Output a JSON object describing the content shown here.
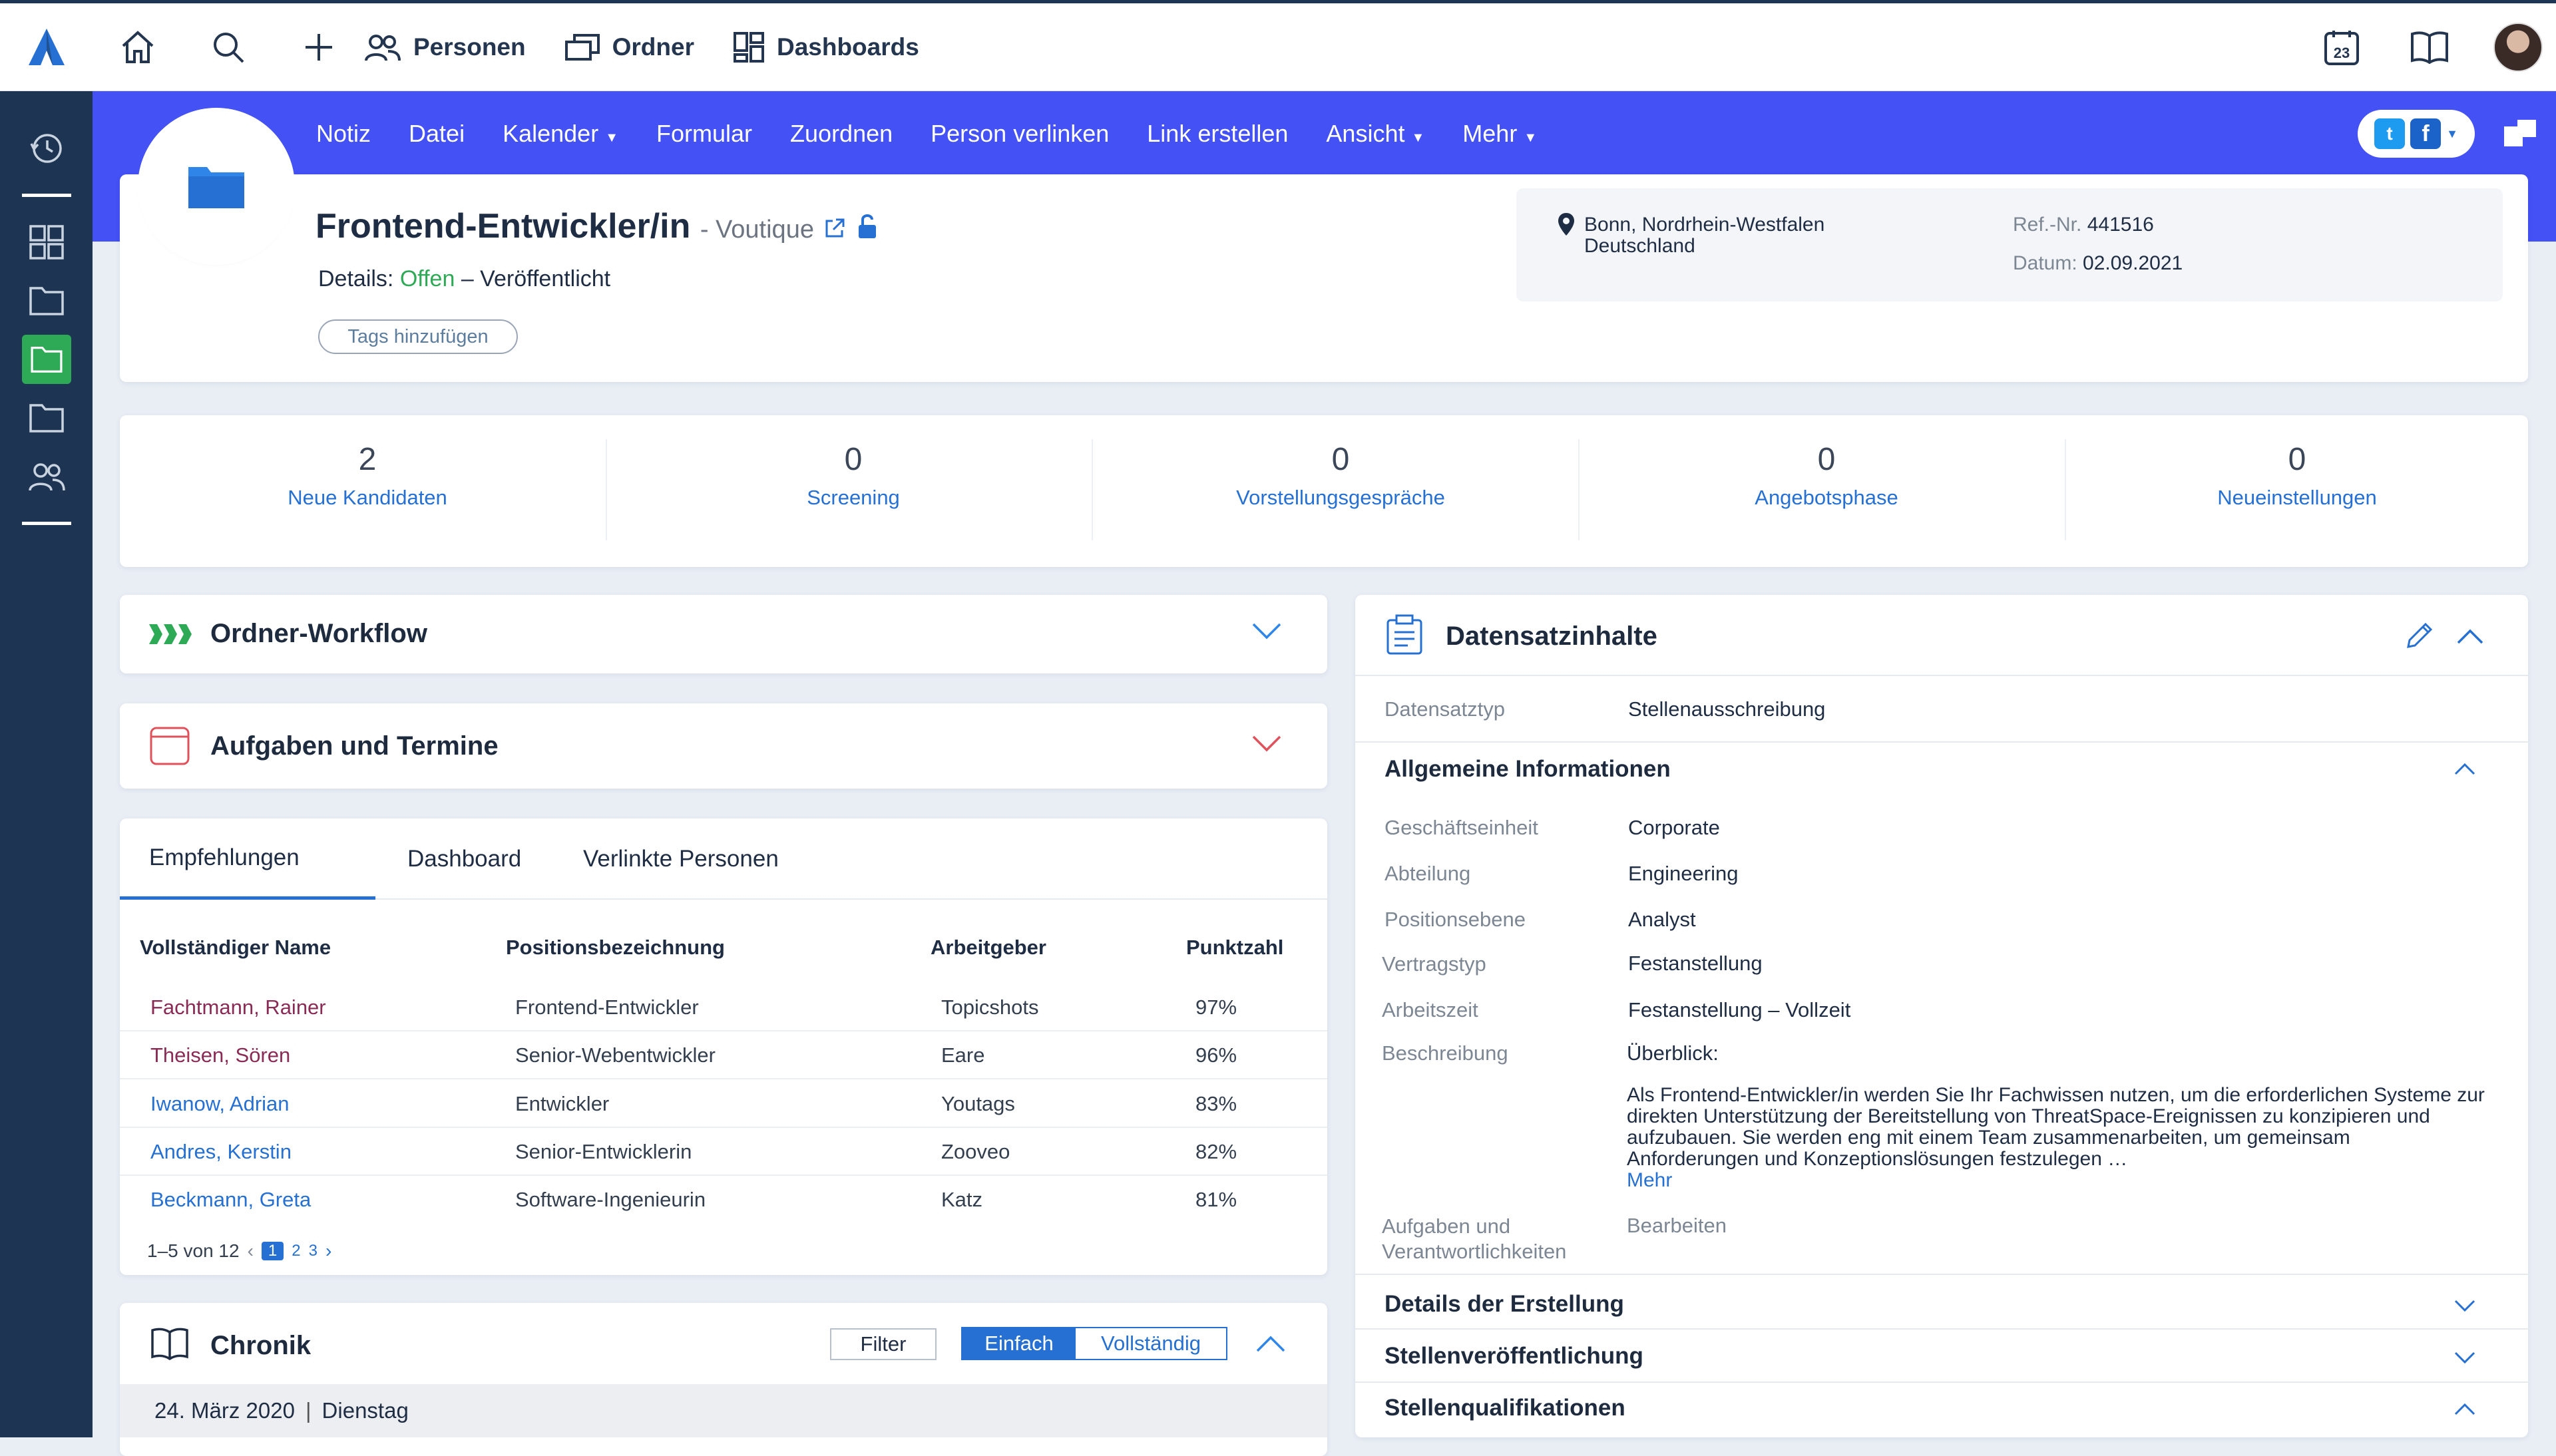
{
  "topbar": {
    "nav": [
      "Personen",
      "Ordner",
      "Dashboards"
    ],
    "calendar_day": "23"
  },
  "actions": [
    "Notiz",
    "Datei",
    "Kalender",
    "Formular",
    "Zuordnen",
    "Person verlinken",
    "Link erstellen",
    "Ansicht",
    "Mehr"
  ],
  "record": {
    "title": "Frontend-Entwickler/in",
    "company": "- Voutique",
    "details_label": "Details:",
    "status": "Offen",
    "published": "– Veröffentlicht",
    "tags_button": "Tags hinzufügen",
    "location_line1": "Bonn, Nordrhein-Westfalen",
    "location_line2": "Deutschland",
    "ref_label": "Ref.-Nr.",
    "ref_value": "441516",
    "date_label": "Datum:",
    "date_value": "02.09.2021"
  },
  "stats": [
    {
      "value": "2",
      "label": "Neue Kandidaten"
    },
    {
      "value": "0",
      "label": "Screening"
    },
    {
      "value": "0",
      "label": "Vorstellungsgespräche"
    },
    {
      "value": "0",
      "label": "Angebotsphase"
    },
    {
      "value": "0",
      "label": "Neueinstellungen"
    }
  ],
  "sections": {
    "workflow": "Ordner-Workflow",
    "tasks": "Aufgaben und Termine",
    "chronik": "Chronik"
  },
  "tabs": [
    "Empfehlungen",
    "Dashboard",
    "Verlinkte Personen"
  ],
  "table": {
    "headers": [
      "Vollständiger Name",
      "Positionsbezeichnung",
      "Arbeitgeber",
      "Punktzahl"
    ],
    "rows": [
      {
        "name": "Fachtmann, Rainer",
        "position": "Frontend-Entwickler",
        "employer": "Topicshots",
        "score": "97%"
      },
      {
        "name": "Theisen, Sören",
        "position": "Senior-Webentwickler",
        "employer": "Eare",
        "score": "96%"
      },
      {
        "name": "Iwanow, Adrian",
        "position": "Entwickler",
        "employer": "Youtags",
        "score": "83%"
      },
      {
        "name": "Andres, Kerstin",
        "position": "Senior-Entwicklerin",
        "employer": "Zooveo",
        "score": "82%"
      },
      {
        "name": "Beckmann, Greta",
        "position": "Software-Ingenieurin",
        "employer": "Katz",
        "score": "81%"
      }
    ],
    "pagination_text": "1–5 von 12",
    "pages": [
      "1",
      "2",
      "3"
    ]
  },
  "chronik": {
    "filter": "Filter",
    "simple": "Einfach",
    "full": "Vollständig",
    "date": "24. März 2020",
    "weekday": "Dienstag"
  },
  "datensatz": {
    "title": "Datensatzinhalte",
    "type_label": "Datensatztyp",
    "type_value": "Stellenausschreibung",
    "general_title": "Allgemeine Informationen",
    "fields": [
      {
        "label": "Geschäftseinheit",
        "value": "Corporate"
      },
      {
        "label": "Abteilung",
        "value": "Engineering"
      },
      {
        "label": "Positionsebene",
        "value": "Analyst"
      },
      {
        "label": "Vertragstyp",
        "value": "Festanstellung"
      },
      {
        "label": "Arbeitszeit",
        "value": "Festanstellung – Vollzeit"
      },
      {
        "label": "Beschreibung",
        "value": "Überblick:"
      }
    ],
    "description": "Als Frontend-Entwickler/in werden Sie Ihr Fachwissen nutzen, um die erforderlichen Systeme zur direkten Unterstützung der Bereitstellung von ThreatSpace-Ereignissen zu konzipieren und aufzubauen. Sie werden eng mit einem Team zusammenarbeiten, um gemeinsam Anforderungen und Konzeptionslösungen festzulegen …",
    "more": "Mehr",
    "resp_label_1": "Aufgaben und",
    "resp_label_2": "Verantwortlichkeiten",
    "resp_value": "Bearbeiten",
    "collapsed": [
      "Details der Erstellung",
      "Stellenveröffentlichung",
      "Stellenqualifikationen"
    ]
  },
  "colors": {
    "accent": "#4351f5",
    "sidebar": "#1d3553",
    "link": "#2570d2",
    "green": "#2eaa56",
    "red": "#e0525b"
  }
}
